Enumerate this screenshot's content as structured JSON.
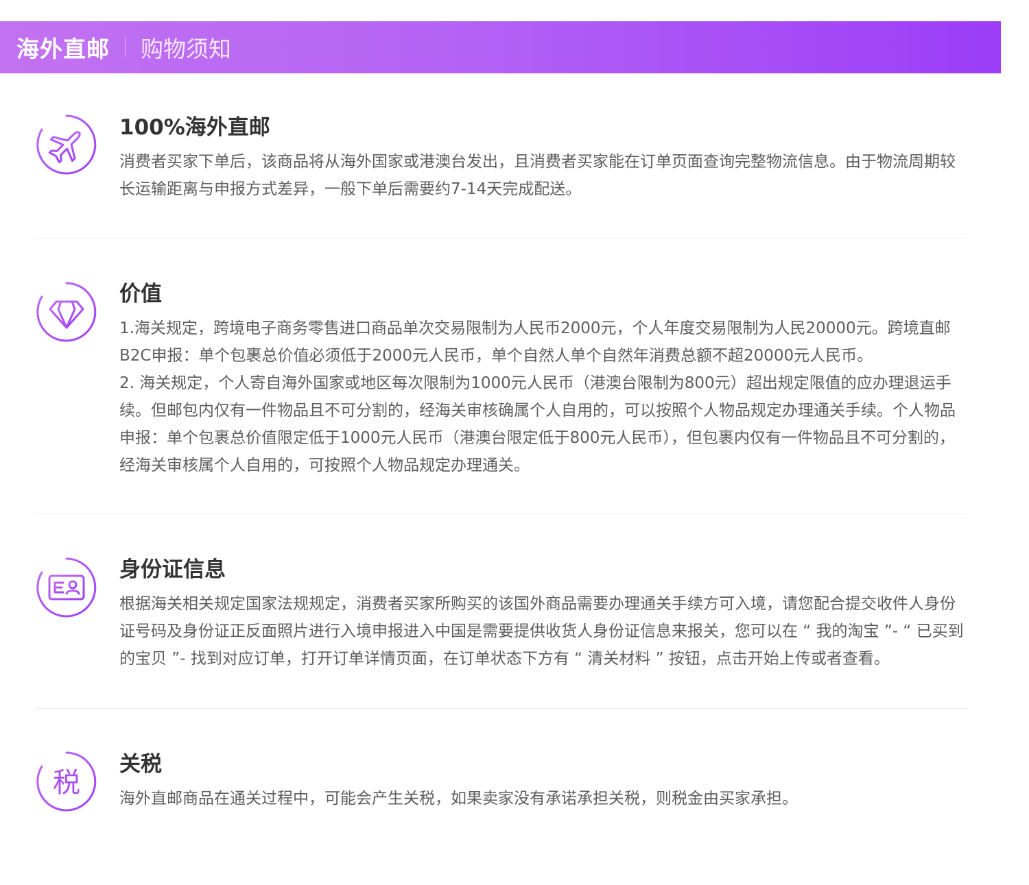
{
  "header": {
    "title": "海外直邮",
    "subtitle": "购物须知"
  },
  "sections": [
    {
      "icon": "airplane-icon",
      "title": "100%海外直邮",
      "paragraphs": [
        "消费者买家下单后，该商品将从海外国家或港澳台发出，且消费者买家能在订单页面查询完整物流信息。由于物流周期较长运输距离与申报方式差异，一般下单后需要约7-14天完成配送。"
      ]
    },
    {
      "icon": "diamond-icon",
      "title": "价值",
      "paragraphs": [
        "1.海关规定，跨境电子商务零售进口商品单次交易限制为人民币2000元，个人年度交易限制为人民20000元。跨境直邮B2C申报：单个包裹总价值必须低于2000元人民币，单个自然人单个自然年消费总额不超20000元人民币。",
        "2. 海关规定，个人寄自海外国家或地区每次限制为1000元人民币（港澳台限制为800元）超出规定限值的应办理退运手续。但邮包内仅有一件物品且不可分割的，经海关审核确属个人自用的，可以按照个人物品规定办理通关手续。个人物品申报：单个包裹总价值限定低于1000元人民币（港澳台限定低于800元人民币），但包裹内仅有一件物品且不可分割的，经海关审核属个人自用的，可按照个人物品规定办理通关。"
      ]
    },
    {
      "icon": "id-card-icon",
      "title": "身份证信息",
      "paragraphs": [
        "根据海关相关规定国家法规规定，消费者买家所购买的该国外商品需要办理通关手续方可入境，请您配合提交收件人身份证号码及身份证正反面照片进行入境申报进入中国是需要提供收货人身份证信息来报关，您可以在 “ 我的淘宝 ”- “ 已买到的宝贝 ”- 找到对应订单，打开订单详情页面，在订单状态下方有 “ 清关材料 ” 按钮，点击开始上传或者查看。"
      ]
    },
    {
      "icon": "tax-icon",
      "icon_text": "税",
      "title": "关税",
      "paragraphs": [
        "海外直邮商品在通关过程中，可能会产生关税，如果卖家没有承诺承担关税，则税金由买家承担。"
      ]
    }
  ],
  "colors": {
    "accent": "#b455f5",
    "header_start": "#c272f0",
    "header_end": "#9b3df8",
    "title_text": "#333333",
    "body_text": "#5e5e5e",
    "divider": "#ececec"
  }
}
